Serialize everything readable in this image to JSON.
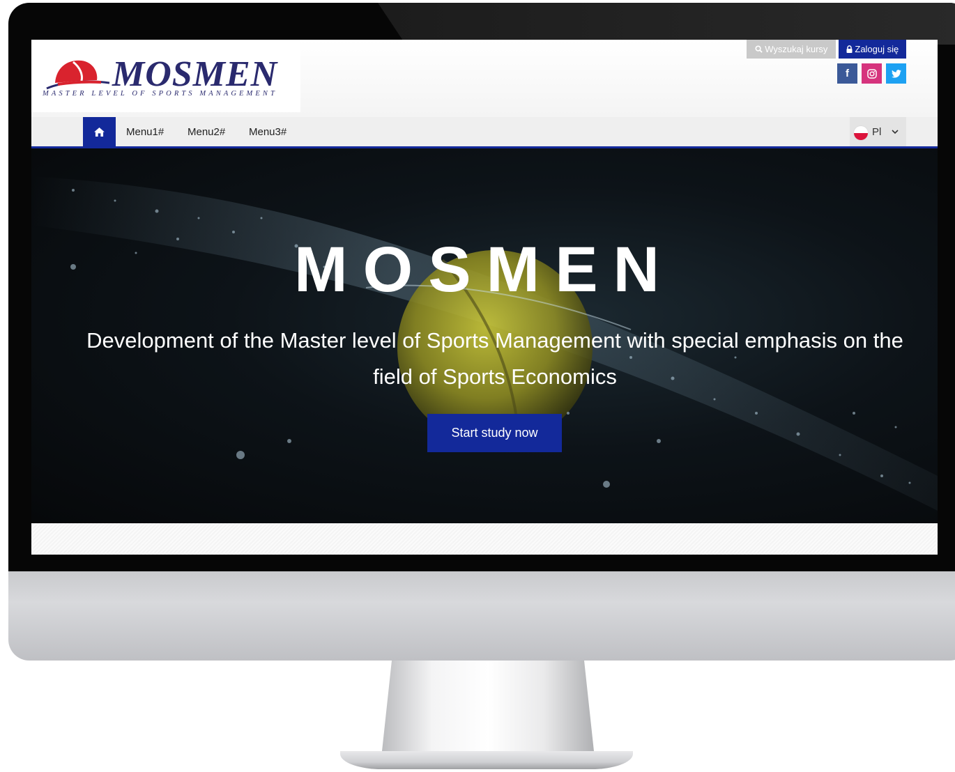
{
  "brand": {
    "logo_text": "MOSMEN",
    "logo_tagline": "MASTER LEVEL OF SPORTS MANAGEMENT",
    "primary_color": "#13299a"
  },
  "header": {
    "search_button": {
      "icon": "search-icon",
      "label": "Wyszukaj kursy"
    },
    "login_button": {
      "icon": "lock-icon",
      "label": "Zaloguj się"
    },
    "social": [
      {
        "name": "facebook",
        "icon": "facebook-icon",
        "glyph": "f",
        "color": "#3b5998"
      },
      {
        "name": "instagram",
        "icon": "instagram-icon",
        "color": "#d6337d"
      },
      {
        "name": "twitter",
        "icon": "twitter-icon",
        "color": "#1da1f2"
      }
    ]
  },
  "nav": {
    "home_icon": "home-icon",
    "items": [
      {
        "label": "Menu1#"
      },
      {
        "label": "Menu2#"
      },
      {
        "label": "Menu3#"
      }
    ],
    "language": {
      "flag_icon": "poland-flag-icon",
      "code": "Pl",
      "chevron": "chevron-down-icon"
    }
  },
  "hero": {
    "title": "MOSMEN",
    "subtitle": "Development of the Master level of Sports Management with special emphasis on the field of Sports Economics",
    "cta_label": "Start study now"
  }
}
